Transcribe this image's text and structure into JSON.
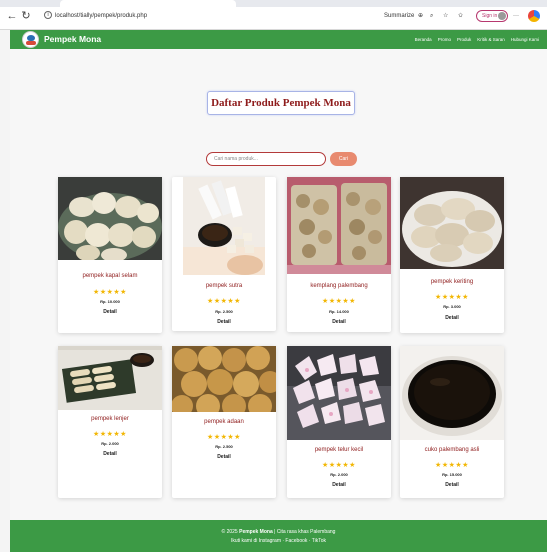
{
  "browser": {
    "url": "localhost/tially/pempek/produk.php",
    "summarize": "Summarize",
    "sign_in": "Sign in",
    "menu_more": "···"
  },
  "navbar": {
    "brand": "Pempek Mona",
    "menu": [
      "Beranda",
      "Promo",
      "Produk",
      "Kritik & Saran",
      "Hubungi Kami"
    ]
  },
  "page": {
    "title": "Daftar Produk Pempek Mona",
    "search_placeholder": "Cari nama produk...",
    "search_button": "Cari"
  },
  "products": [
    {
      "name": "pempek kapal selam",
      "stars": "★★★★★",
      "price": "Rp. 10.000",
      "detail": "Detail"
    },
    {
      "name": "pempek sutra",
      "stars": "★★★★★",
      "price": "Rp. 2.500",
      "detail": "Detail"
    },
    {
      "name": "kemplang palembang",
      "stars": "★★★★★",
      "price": "Rp. 14.000",
      "detail": "Detail"
    },
    {
      "name": "pempek keriting",
      "stars": "★★★★★",
      "price": "Rp. 3.000",
      "detail": "Detail"
    },
    {
      "name": "pempek lenjer",
      "stars": "★★★★★",
      "price": "Rp. 2.000",
      "detail": "Detail"
    },
    {
      "name": "pempek adaan",
      "stars": "★★★★★",
      "price": "Rp. 2.500",
      "detail": "Detail"
    },
    {
      "name": "pempek telur kecil",
      "stars": "★★★★★",
      "price": "Rp. 2.000",
      "detail": "Detail"
    },
    {
      "name": "cuko palembang asli",
      "stars": "★★★★★",
      "price": "Rp. 15.000",
      "detail": "Detail"
    }
  ],
  "footer": {
    "copyright_prefix": "© 2025",
    "brand": "Pempek Mona",
    "tagline": "| Cita rasa khas Palembang",
    "follow": "Ikuti kami di Instagram · Facebook · TikTok"
  },
  "colors": {
    "navbar": "#3c9a45",
    "product_name": "#8e1b1b",
    "stars": "#f2b705",
    "search_button": "#e88a6f"
  }
}
